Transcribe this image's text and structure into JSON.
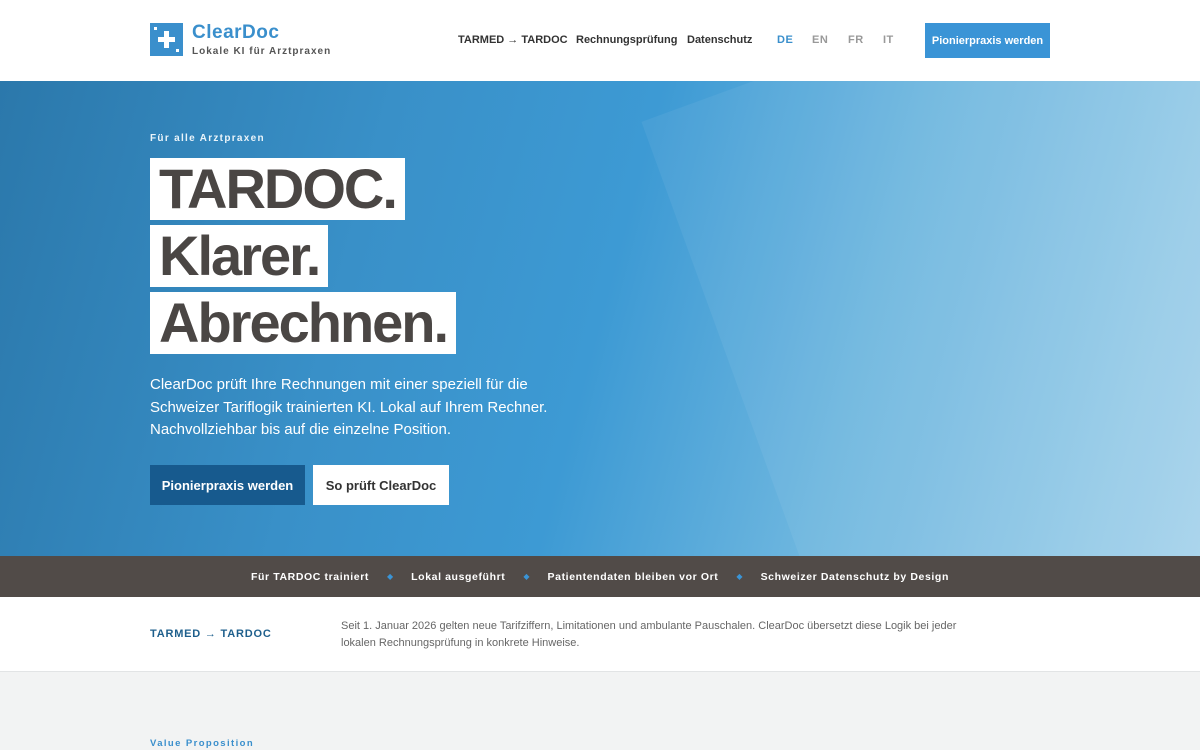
{
  "brand": {
    "name": "ClearDoc",
    "tagline": "Lokale KI für Arztpraxen",
    "color": "#3a8fcc",
    "logo_icon": "medical-plus-icon"
  },
  "nav": {
    "links": [
      "TARMED → TARDOC",
      "Rechnungsprüfung",
      "Datenschutz"
    ],
    "languages": [
      "DE",
      "EN",
      "FR",
      "IT"
    ],
    "active_language": "DE",
    "cta_label": "Pionierpraxis werden"
  },
  "hero": {
    "eyebrow": "Für alle Arztpraxen",
    "headline": [
      "TARDOC.",
      "Klarer.",
      "Abrechnen."
    ],
    "copy": "ClearDoc prüft Ihre Rechnungen mit einer speziell für die Schweizer Tariflogik trainierten KI. Lokal auf Ihrem Rechner. Nachvollziehbar bis auf die einzelne Position.",
    "primary_button": "Pionierpraxis werden",
    "secondary_button": "So prüft ClearDoc"
  },
  "features": {
    "items": [
      "Für TARDOC trainiert",
      "Lokal ausgeführt",
      "Patientendaten bleiben vor Ort",
      "Schweizer Datenschutz by Design"
    ],
    "separator": "◆"
  },
  "info": {
    "label": "TARMED → TARDOC",
    "text": "Seit 1. Januar 2026 gelten neue Tarifziffern, Limitationen und ambulante Pauschalen. ClearDoc übersetzt diese Logik bei jeder lokalen Rechnungsprüfung in konkrete Hinweise."
  },
  "next_section": {
    "eyebrow": "Value Proposition"
  },
  "colors": {
    "accent": "#3a94d6",
    "primary_dark": "#175a8e",
    "strip_bg": "#514b48",
    "headline_text": "#4a4644"
  }
}
